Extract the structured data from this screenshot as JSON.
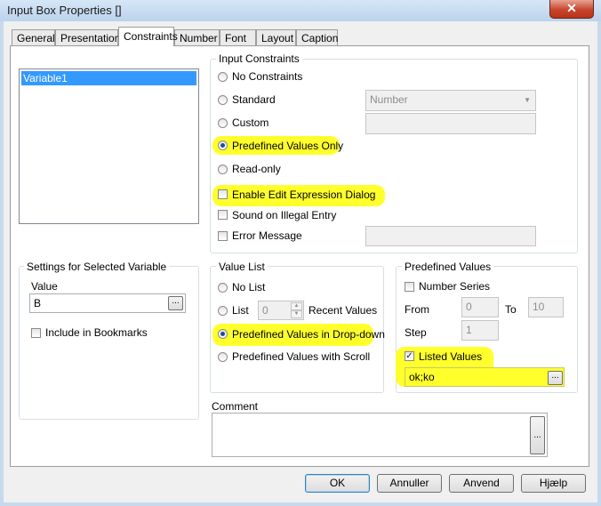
{
  "window": {
    "title": "Input Box Properties []",
    "close_glyph": "✕"
  },
  "tabs": [
    "General",
    "Presentation",
    "Constraints",
    "Number",
    "Font",
    "Layout",
    "Caption"
  ],
  "active_tab": "Constraints",
  "variables": {
    "items": [
      "Variable1"
    ],
    "selected": "Variable1"
  },
  "input_constraints": {
    "legend": "Input Constraints",
    "no_constraints": "No Constraints",
    "standard": "Standard",
    "standard_select": "Number",
    "custom": "Custom",
    "predefined_only": "Predefined Values Only",
    "read_only": "Read-only",
    "enable_edit_expression": "Enable Edit Expression Dialog",
    "sound_illegal": "Sound on Illegal Entry",
    "error_message": "Error Message",
    "selected": "Predefined Values Only"
  },
  "settings": {
    "legend": "Settings for Selected Variable",
    "value_label": "Value",
    "value": "B",
    "browse": "...",
    "include_bookmarks": "Include in Bookmarks"
  },
  "value_list": {
    "legend": "Value List",
    "no_list": "No List",
    "list": "List",
    "list_count": "0",
    "recent_values": "Recent Values",
    "dropdown": "Predefined Values in Drop-down",
    "scroll": "Predefined Values with Scroll",
    "selected": "Predefined Values in Drop-down"
  },
  "predefined": {
    "legend": "Predefined Values",
    "number_series": "Number Series",
    "from_label": "From",
    "from_value": "0",
    "to_label": "To",
    "to_value": "10",
    "step_label": "Step",
    "step_value": "1",
    "listed_values": "Listed Values",
    "listed_checked": true,
    "listed_text": "ok;ko",
    "browse": "..."
  },
  "comment": {
    "label": "Comment",
    "value": "",
    "browse": "..."
  },
  "buttons": {
    "ok": "OK",
    "cancel": "Annuller",
    "apply": "Anvend",
    "help": "Hjælp"
  },
  "highlight_color": "#ffff2b",
  "selection_color": "#3399ff"
}
